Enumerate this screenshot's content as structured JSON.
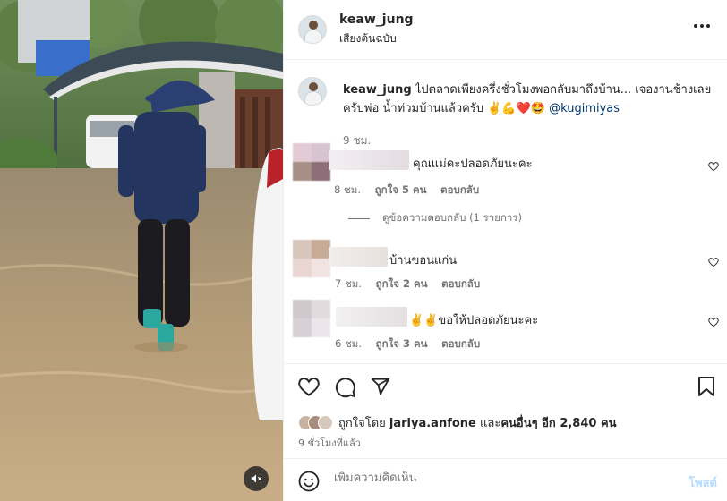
{
  "post": {
    "username": "keaw_jung",
    "audio_label": "เสียงต้นฉบับ"
  },
  "caption": {
    "username": "keaw_jung",
    "text": " ไปตลาดเพียงครึ่งชั่วโมงพอกลับมาถึงบ้าน... เจองานช้างเลยครับพ่อ น้ำท่วมบ้านแล้วครับ ✌️💪❤️🤩 ",
    "mention": "@kugimiyas",
    "time": "9 ชม."
  },
  "comments": [
    {
      "text": "คุณแม่คะปลอดภัยนะคะ",
      "time": "8 ชม.",
      "likes": "ถูกใจ 5 คน",
      "reply_label": "ตอบกลับ",
      "avatar_colors": [
        "#e2cbd4",
        "#d8c3d0",
        "#a58f86",
        "#8e6f79"
      ]
    },
    {
      "text": "บ้านขอนแก่น",
      "time": "7 ชม.",
      "likes": "ถูกใจ 2 คน",
      "reply_label": "ตอบกลับ",
      "avatar_colors": [
        "#d8c6bd",
        "#c7ab97",
        "#e9d5d1",
        "#f0e3e1"
      ]
    },
    {
      "text": "✌️✌️ขอให้ปลอดภัยนะคะ",
      "time": "6 ชม.",
      "likes": "ถูกใจ 3 คน",
      "reply_label": "ตอบกลับ",
      "avatar_colors": [
        "#cfc9cd",
        "#e2dadd",
        "#d8d0d5",
        "#ece6ea"
      ]
    }
  ],
  "view_replies": "ดูข้อความตอบกลับ (1 รายการ)",
  "likes": {
    "prefix": "ถูกใจโดย ",
    "user": "jariya.anfone",
    "middle": " และ",
    "others": "คนอื่นๆ อีก 2,840 คน"
  },
  "post_time": "9 ชั่วโมงที่แล้ว",
  "composer": {
    "placeholder": "เพิ่มความคิดเห็น",
    "post_label": "โพสต์"
  },
  "icons": {
    "more": "more-horizontal-icon",
    "heart": "heart-icon",
    "comment": "comment-icon",
    "share": "send-icon",
    "save": "bookmark-icon",
    "emoji": "emoji-icon",
    "mute": "muted-speaker-icon"
  },
  "colors": {
    "link": "#00376b",
    "muted_text": "#737373",
    "post_button_disabled": "#b3dbff",
    "border": "#efefef"
  }
}
